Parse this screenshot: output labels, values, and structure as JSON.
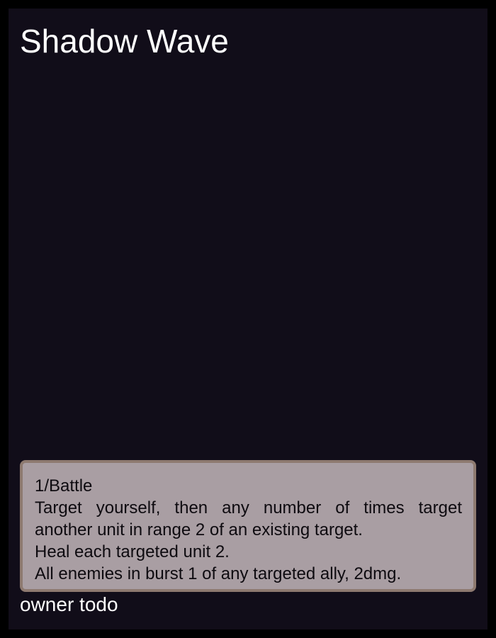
{
  "card": {
    "title": "Shadow Wave",
    "rules": {
      "frequency": "1/Battle",
      "line1": "Target yourself, then any number of times target",
      "line2": "another unit in range 2 of an existing target.",
      "line3": "Heal each targeted unit 2.",
      "line4": "All enemies in burst 1 of any targeted ally, 2dmg."
    },
    "footer": "owner todo"
  },
  "colors": {
    "page_border": "#000000",
    "card_background": "#110d19",
    "text_box_fill": "#a99ea3",
    "text_box_border": "#8e7a70",
    "title_text": "#ffffff"
  }
}
